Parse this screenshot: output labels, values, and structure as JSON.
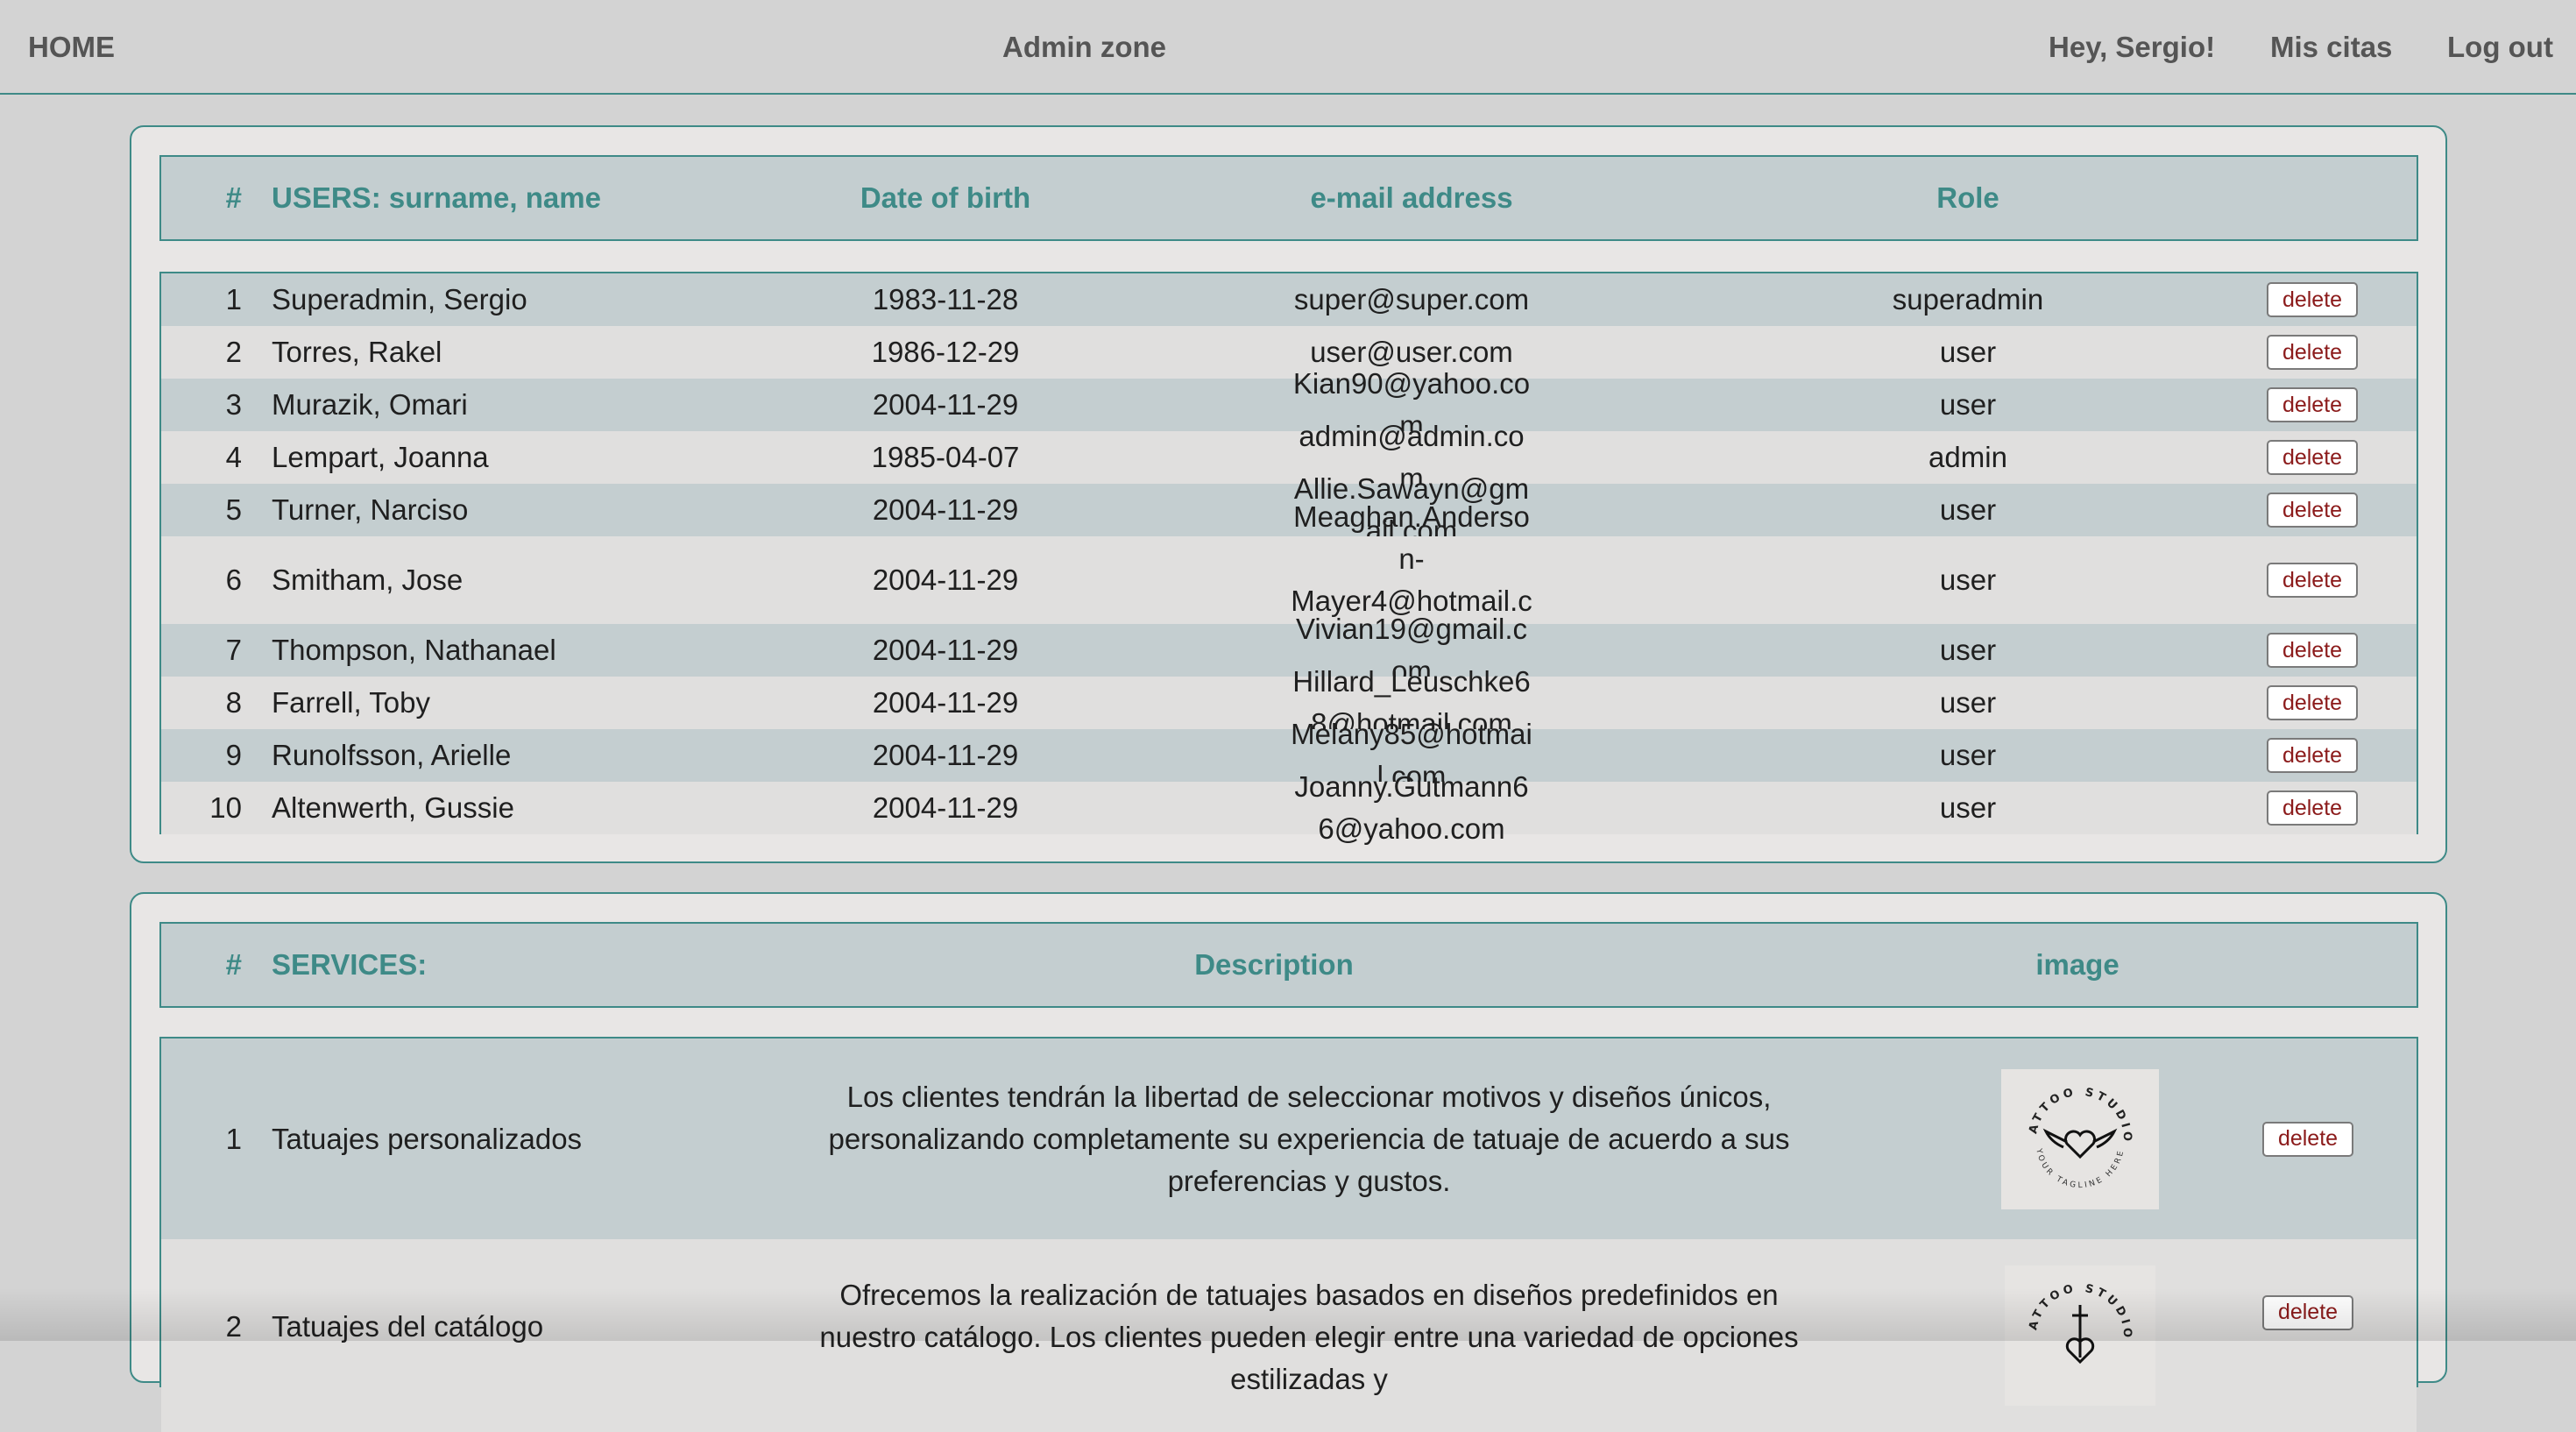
{
  "nav": {
    "home": "HOME",
    "title": "Admin zone",
    "greeting": "Hey, Sergio!",
    "citas": "Mis citas",
    "logout": "Log out"
  },
  "users": {
    "headers": {
      "num": "#",
      "name": "USERS: surname, name",
      "dob": "Date of birth",
      "email": "e-mail address",
      "role": "Role"
    },
    "rows": [
      {
        "num": "1",
        "name": "Superadmin, Sergio",
        "dob": "1983-11-28",
        "email": "super@super.com",
        "role": "superadmin",
        "action": "delete"
      },
      {
        "num": "2",
        "name": "Torres, Rakel",
        "dob": "1986-12-29",
        "email": "user@user.com",
        "role": "user",
        "action": "delete"
      },
      {
        "num": "3",
        "name": "Murazik, Omari",
        "dob": "2004-11-29",
        "email": "Kian90@yahoo.com",
        "role": "user",
        "action": "delete"
      },
      {
        "num": "4",
        "name": "Lempart, Joanna",
        "dob": "1985-04-07",
        "email": "admin@admin.com",
        "role": "admin",
        "action": "delete"
      },
      {
        "num": "5",
        "name": "Turner, Narciso",
        "dob": "2004-11-29",
        "email": "Allie.Sawayn@gmail.com",
        "role": "user",
        "action": "delete"
      },
      {
        "num": "6",
        "name": "Smitham, Jose",
        "dob": "2004-11-29",
        "email": "Meaghan.Anderson-Mayer4@hotmail.com",
        "role": "user",
        "action": "delete"
      },
      {
        "num": "7",
        "name": "Thompson, Nathanael",
        "dob": "2004-11-29",
        "email": "Vivian19@gmail.com",
        "role": "user",
        "action": "delete"
      },
      {
        "num": "8",
        "name": "Farrell, Toby",
        "dob": "2004-11-29",
        "email": "Hillard_Leuschke68@hotmail.com",
        "role": "user",
        "action": "delete"
      },
      {
        "num": "9",
        "name": "Runolfsson, Arielle",
        "dob": "2004-11-29",
        "email": "Melany85@hotmail.com",
        "role": "user",
        "action": "delete"
      },
      {
        "num": "10",
        "name": "Altenwerth, Gussie",
        "dob": "2004-11-29",
        "email": "Joanny.Gutmann66@yahoo.com",
        "role": "user",
        "action": "delete"
      }
    ]
  },
  "services": {
    "headers": {
      "num": "#",
      "name": "SERVICES:",
      "description": "Description",
      "image": "image"
    },
    "rows": [
      {
        "num": "1",
        "name": "Tatuajes personalizados",
        "description": "Los clientes tendrán la libertad de seleccionar motivos y diseños únicos, personalizando completamente su experiencia de tatuaje de acuerdo a sus preferencias y gustos.",
        "logo_top": "TATTOO STUDIO",
        "logo_bottom": "YOUR TAGLINE HERE",
        "logo_icon": "winged-heart-icon",
        "action": "delete"
      },
      {
        "num": "2",
        "name": "Tatuajes del catálogo",
        "description": "Ofrecemos la realización de tatuajes basados en diseños predefinidos en nuestro catálogo. Los clientes pueden elegir entre una variedad de opciones estilizadas y",
        "logo_top": "TATTOO STUDIO",
        "logo_icon": "dagger-heart-icon",
        "action": "delete"
      }
    ]
  }
}
